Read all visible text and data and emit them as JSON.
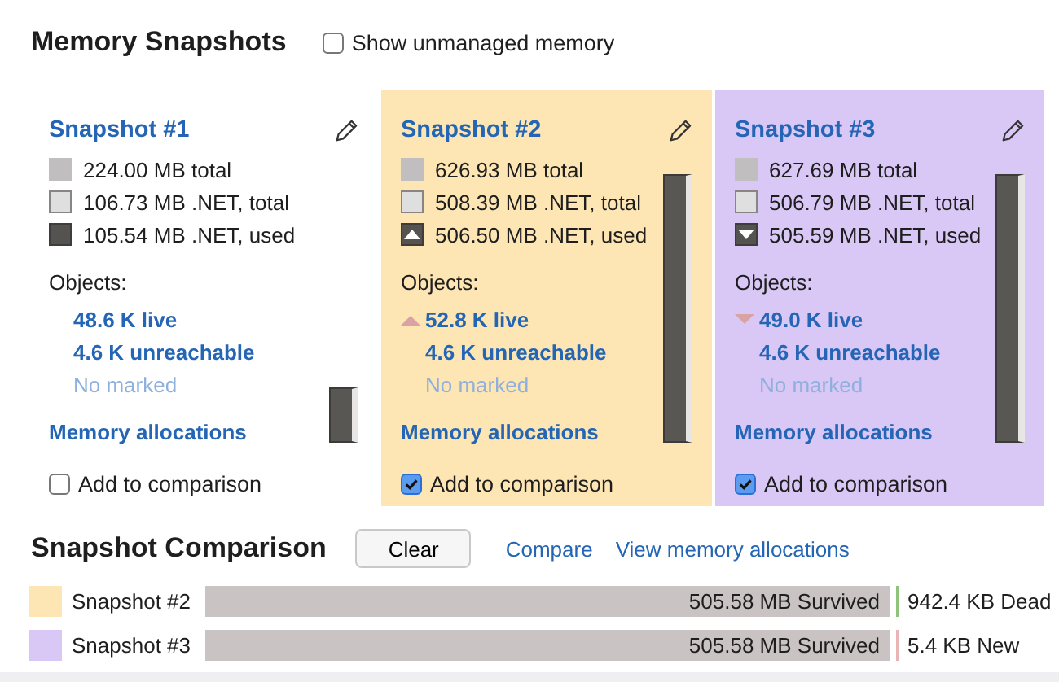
{
  "title": "Memory Snapshots",
  "show_unmanaged": {
    "label": "Show unmanaged memory",
    "checked": false
  },
  "snapshots": [
    {
      "name": "Snapshot #1",
      "color": "#ffffff",
      "legend": [
        {
          "kind": "total",
          "text": "224.00 MB total"
        },
        {
          "kind": "net_total",
          "text": "106.73 MB .NET, total"
        },
        {
          "kind": "net_used",
          "text": "105.54 MB .NET, used"
        }
      ],
      "objects_label": "Objects:",
      "live": {
        "text": "48.6 K live"
      },
      "unreachable": "4.6 K unreachable",
      "marked": "No marked",
      "allocations": "Memory allocations",
      "compare": {
        "label": "Add to comparison",
        "checked": false
      }
    },
    {
      "name": "Snapshot #2",
      "color": "#fde6b3",
      "legend": [
        {
          "kind": "total",
          "text": "626.93 MB total"
        },
        {
          "kind": "net_total",
          "text": "508.39 MB .NET, total"
        },
        {
          "kind": "net_used",
          "text": "506.50 MB .NET, used",
          "increased": true
        }
      ],
      "objects_label": "Objects:",
      "live": {
        "text": "52.8 K live",
        "increased": true
      },
      "unreachable": "4.6 K unreachable",
      "marked": "No marked",
      "allocations": "Memory allocations",
      "compare": {
        "label": "Add to comparison",
        "checked": true
      }
    },
    {
      "name": "Snapshot #3",
      "color": "#d9c7f6",
      "legend": [
        {
          "kind": "total",
          "text": "627.69 MB total"
        },
        {
          "kind": "net_total",
          "text": "506.79 MB .NET, total"
        },
        {
          "kind": "net_used",
          "text": "505.59 MB .NET, used",
          "increased": false
        }
      ],
      "objects_label": "Objects:",
      "live": {
        "text": "49.0 K live",
        "increased": false
      },
      "unreachable": "4.6 K unreachable",
      "marked": "No marked",
      "allocations": "Memory allocations",
      "compare": {
        "label": "Add to comparison",
        "checked": true
      }
    }
  ],
  "comparison": {
    "title": "Snapshot Comparison",
    "clear": "Clear",
    "links": [
      "Compare",
      "View memory allocations"
    ],
    "rows": [
      {
        "label": "Snapshot #2",
        "color": "#fde6b3",
        "bar_text": "505.58 MB Survived",
        "kind": "dead",
        "side_text": "942.4 KB Dead"
      },
      {
        "label": "Snapshot #3",
        "color": "#d9c7f6",
        "bar_text": "505.58 MB Survived",
        "kind": "new",
        "side_text": "5.4 KB New"
      }
    ]
  }
}
